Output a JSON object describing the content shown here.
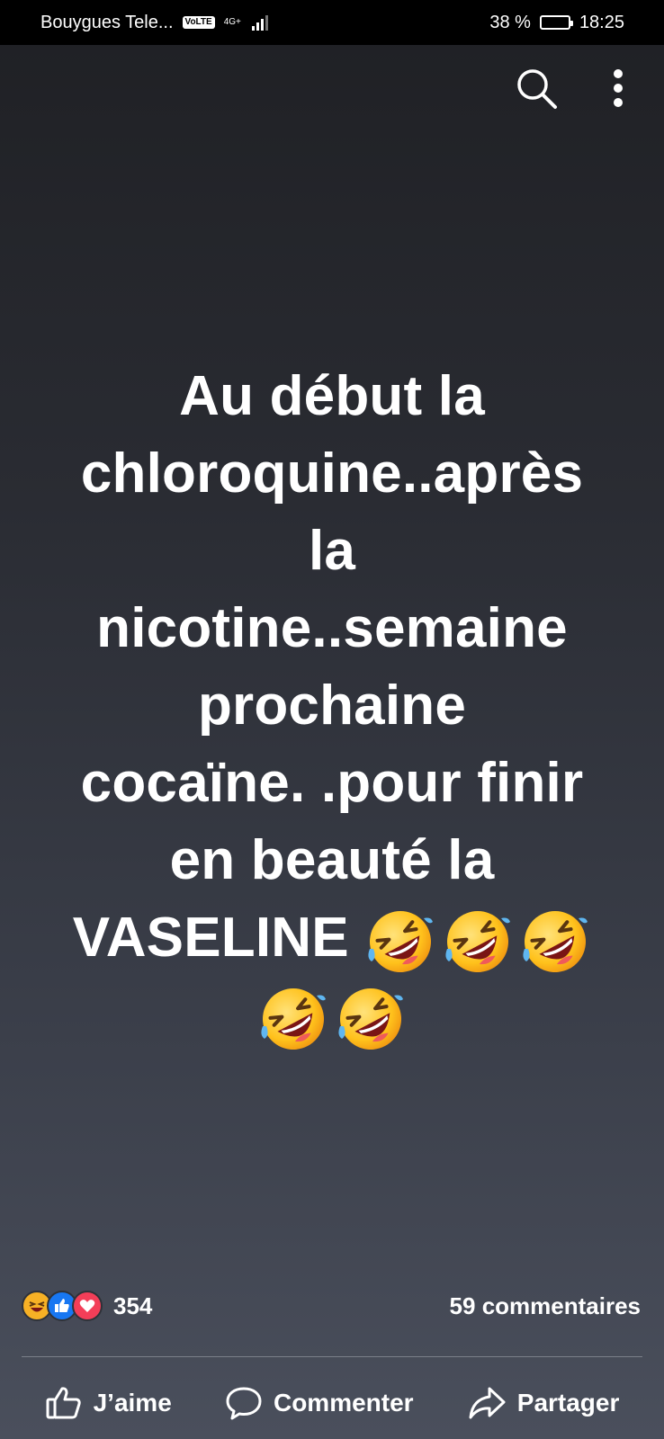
{
  "status_bar": {
    "carrier": "Bouygues Tele...",
    "volte": "VoLTE",
    "network": "4G+",
    "battery": "38 %",
    "battery_level": 0.38,
    "time": "18:25"
  },
  "top_actions": {
    "icons": [
      "search-icon",
      "more-options-icon"
    ]
  },
  "post": {
    "lines": [
      "Au début la",
      "chloroquine..après",
      "la",
      "nicotine..semaine",
      "prochaine",
      "cocaïne. .pour finir",
      "en beauté la",
      "VASELINE"
    ],
    "emoji_count": 5
  },
  "reactions": {
    "icons": [
      "laugh-reaction-icon",
      "like-reaction-icon",
      "love-reaction-icon"
    ],
    "count": "354",
    "comments": "59 commentaires"
  },
  "actions": {
    "like": "J’aime",
    "comment": "Commenter",
    "share": "Partager"
  },
  "colors": {
    "like_blue": "#1877f2",
    "love_red": "#f33e58",
    "laugh_yellow": "#f7b125"
  }
}
